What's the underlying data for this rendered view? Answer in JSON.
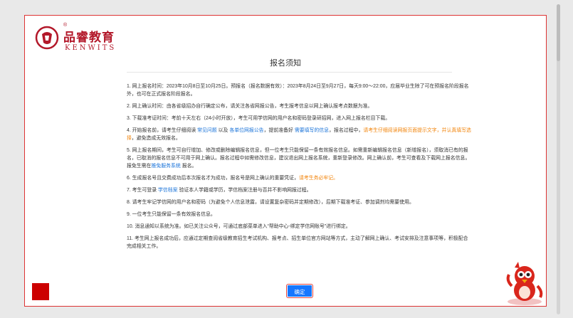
{
  "logo": {
    "cn": "品睿教育",
    "en": "KENWITS",
    "reg": "®"
  },
  "title": "报名须知",
  "paragraphs": [
    [
      {
        "t": "1. 网上报名时间：2023年10月8日至10月25日。预报名（报名数据有效）：2023年8月24日至9月27日，每天9:00～22:00，应届毕业生除了可在预报名阶段报名外，也可在正式报名阶段报名。",
        "c": ""
      }
    ],
    [
      {
        "t": "2. 网上确认时间：由各省级招办自行确定公布，请关注各省网报公告，考生报考信息以网上确认报考点数据为准。",
        "c": ""
      }
    ],
    [
      {
        "t": "3. 下载准考证时间：考前十天左右（24小时开放），考生可用学信网的用户名和密码登录研招网，进入网上报名栏目下载。",
        "c": ""
      }
    ],
    [
      {
        "t": "4. 开始报名前，请考生仔细阅读 ",
        "c": ""
      },
      {
        "t": "常见问题",
        "c": "blue"
      },
      {
        "t": " 以及 ",
        "c": ""
      },
      {
        "t": "各单位网报公告",
        "c": "blue"
      },
      {
        "t": "，提前准备好 ",
        "c": ""
      },
      {
        "t": "需要填写的信息",
        "c": "blue"
      },
      {
        "t": "，报名过程中，",
        "c": ""
      },
      {
        "t": "请考生仔细阅读网报页面提示文字，并认真填写选择",
        "c": "orange"
      },
      {
        "t": "，避免造成无效报名。",
        "c": ""
      }
    ],
    [
      {
        "t": "5. 网上报名期间，考生可自行增加、修改或删除编辑报名信息，但一位考生只能保留一条有效报名信息。如需重新编辑报名信息（新增报名），须取消已有的报名，已取消的报名信息不可用于网上确认。报名过程中如需修改信息，建议退出网上报名系统，重新登录修改。网上确认前，考生可查看及下载网上报名信息。报免生需在",
        "c": ""
      },
      {
        "t": "推免服务系统",
        "c": "blue"
      },
      {
        "t": " 报名。",
        "c": ""
      }
    ],
    [
      {
        "t": "6. 生成报名号且交费成功后本次报名才为成功，报名号是网上确认的重要凭证，",
        "c": ""
      },
      {
        "t": "请考生务必牢记。",
        "c": "orange"
      }
    ],
    [
      {
        "t": "7. 考生可登录 ",
        "c": ""
      },
      {
        "t": "学信档案",
        "c": "blue"
      },
      {
        "t": " 验证本人学籍或学历，学信档案注册与否并不影响网报过程。",
        "c": ""
      }
    ],
    [
      {
        "t": "8. 请考生牢记学信网的用户名和密码（为避免个人信息泄露，请设置复杂密码并定期修改），后期下载准考证、参加调剂均需要使用。",
        "c": ""
      }
    ],
    [
      {
        "t": "9. 一位考生只能保留一条有效报名信息。",
        "c": ""
      }
    ],
    [
      {
        "t": "10. 消息通知以系统为准。如已关注公众号，可通过底部菜单进入“帮助中心-绑定学信网账号”进行绑定。",
        "c": ""
      }
    ],
    [
      {
        "t": "11. 考生网上报名成功后，应通过定期查阅省级教育招生考试机构、报考点、招生单位官方网站等方式，主动了解网上确认、考试安排及注意事项等，积极配合完成相关工作。",
        "c": ""
      }
    ]
  ],
  "confirm_label": "确定",
  "colors": {
    "link_blue": "#1a73d9",
    "warn_orange": "#f2850c",
    "brand_red": "#b3182a",
    "button_blue": "#1677ff"
  }
}
